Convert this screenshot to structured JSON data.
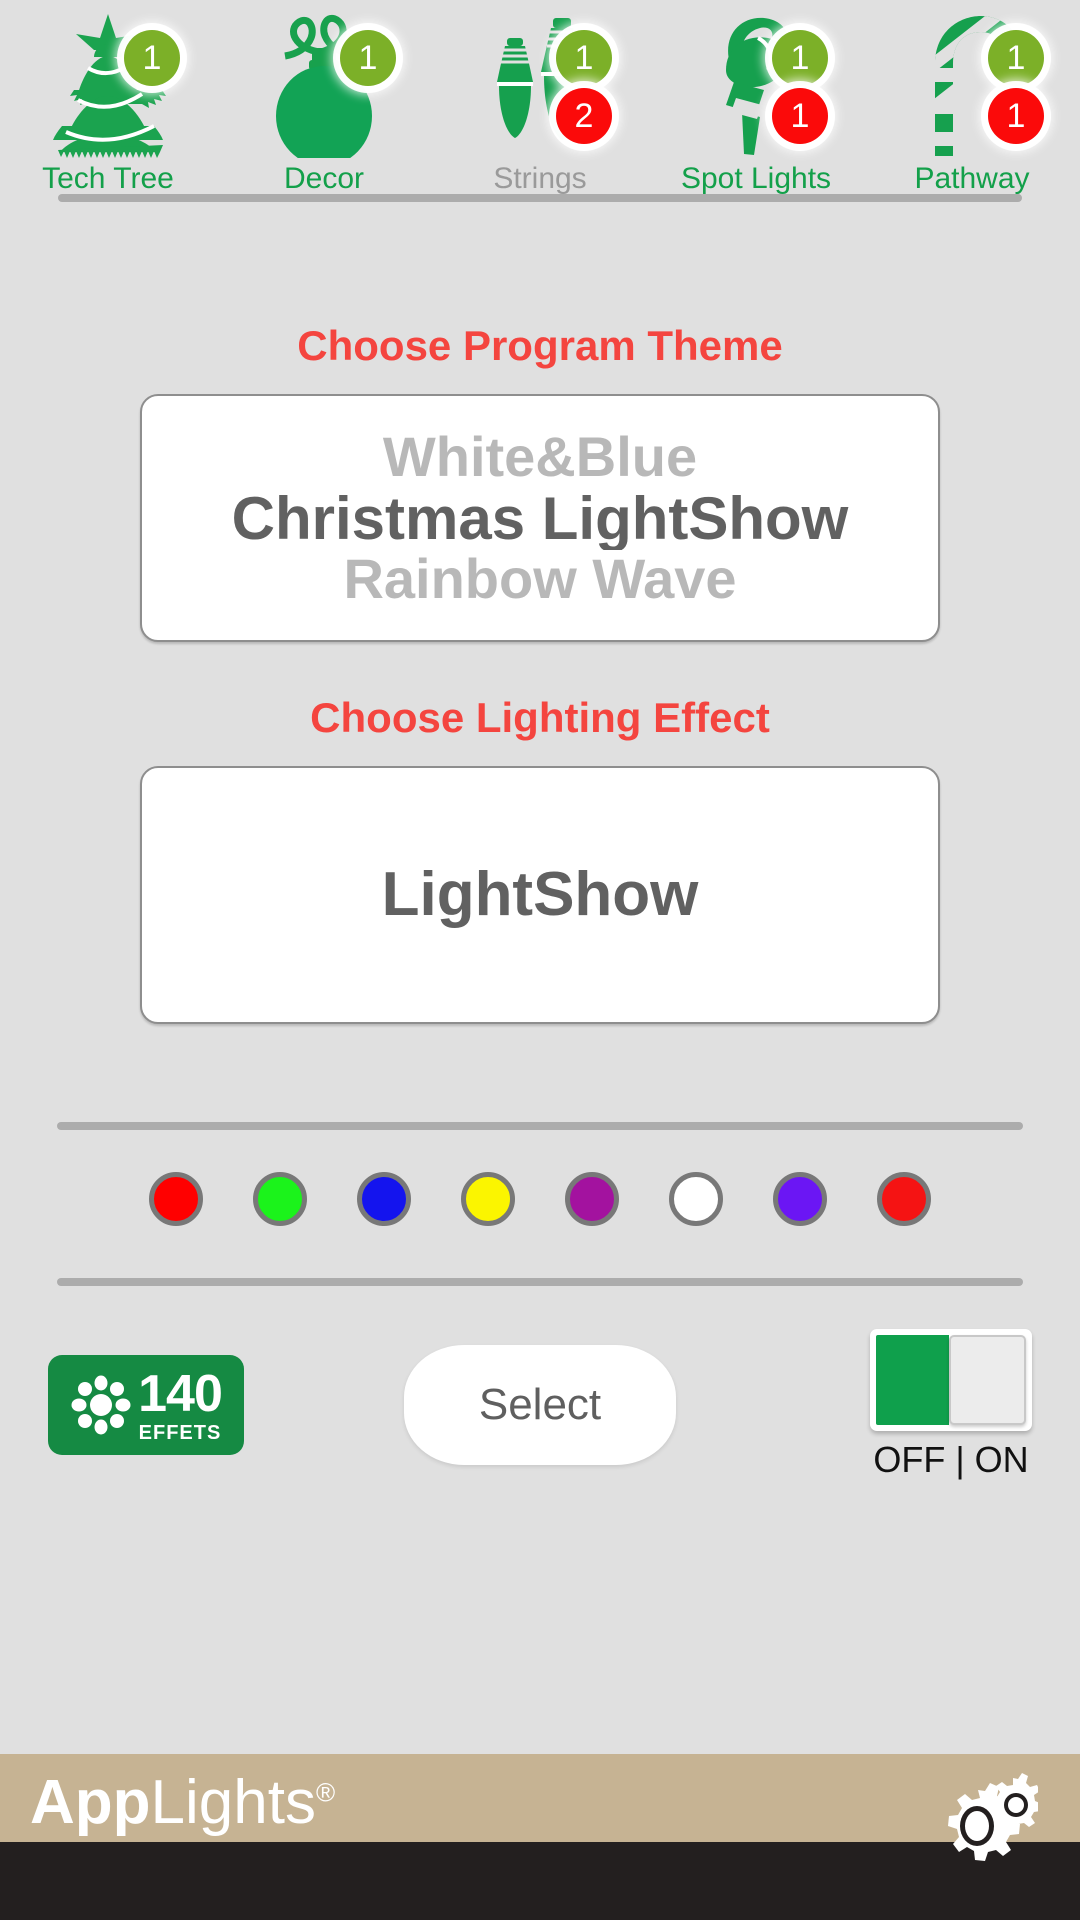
{
  "devices": [
    {
      "label": "Tech Tree",
      "icon": "christmas-tree-icon",
      "active": true,
      "green_badge": "1",
      "red_badge": null
    },
    {
      "label": "Decor",
      "icon": "ornament-ball-icon",
      "active": true,
      "green_badge": "1",
      "red_badge": null
    },
    {
      "label": "Strings",
      "icon": "light-bulbs-icon",
      "active": false,
      "green_badge": "1",
      "red_badge": "2"
    },
    {
      "label": "Spot Lights",
      "icon": "spotlight-stake-icon",
      "active": true,
      "green_badge": "1",
      "red_badge": "1"
    },
    {
      "label": "Pathway",
      "icon": "candy-cane-icon",
      "active": true,
      "green_badge": "1",
      "red_badge": "1"
    }
  ],
  "theme_section": {
    "title": "Choose Program Theme",
    "options": [
      "White&Blue",
      "Christmas LightShow",
      "Rainbow Wave"
    ],
    "selected": "Christmas LightShow",
    "selected_index": 1
  },
  "effect_section": {
    "title": "Choose Lighting Effect",
    "options": [
      "LightShow"
    ],
    "selected": "LightShow",
    "selected_index": 0
  },
  "color_swatches": [
    {
      "name": "red",
      "hex": "#ff0000"
    },
    {
      "name": "green",
      "hex": "#1bf31b"
    },
    {
      "name": "blue",
      "hex": "#1414ee"
    },
    {
      "name": "yellow",
      "hex": "#fbf500"
    },
    {
      "name": "magenta",
      "hex": "#a3129f"
    },
    {
      "name": "white",
      "hex": "#ffffff"
    },
    {
      "name": "violet",
      "hex": "#6b16f4"
    },
    {
      "name": "red2",
      "hex": "#f51313"
    }
  ],
  "controls": {
    "effects_count": "140",
    "effects_word": "EFFETS",
    "select_label": "Select",
    "power_toggle": {
      "label": "OFF | ON",
      "state": "on"
    }
  },
  "footer": {
    "brand_bold": "App",
    "brand_light": "Lights",
    "brand_mark": "®",
    "settings_icon": "gears-icon"
  },
  "colors": {
    "background": "#e0e0e0",
    "accent_red": "#f4453f",
    "device_green": "#13a04a",
    "device_inactive": "#9a9a9a",
    "badge_green": "#7cb028",
    "badge_red": "#fb0a0a",
    "toggle_green": "#0fa04c",
    "effects_green": "#158a43",
    "footer_tan": "#c6b393",
    "footer_dark": "#231f1f",
    "picker_selected": "#616161",
    "picker_dim": "#b8b8b8",
    "divider": "#acacac"
  }
}
